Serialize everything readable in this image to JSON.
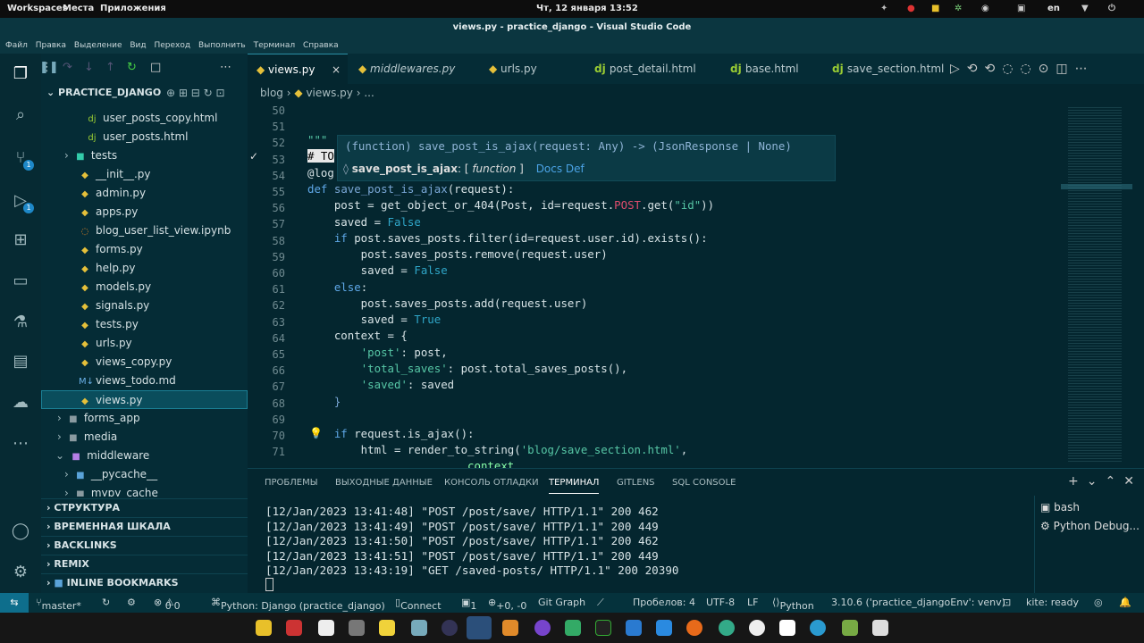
{
  "topbar": {
    "workspaces": "Workspaces",
    "places": "Места",
    "apps": "Приложения",
    "datetime": "Чт, 12 января  13:52",
    "lang": "en"
  },
  "window_title": "views.py - practice_django - Visual Studio Code",
  "menu": [
    "Файл",
    "Правка",
    "Выделение",
    "Вид",
    "Переход",
    "Выполнить",
    "Терминал",
    "Справка"
  ],
  "activity": {
    "badges": [
      "1",
      "1"
    ]
  },
  "sidebar": {
    "project": "PRACTICE_DJANGO",
    "items": [
      {
        "label": "user_posts_copy.html",
        "icon": "dj"
      },
      {
        "label": "user_posts.html",
        "icon": "dj"
      },
      {
        "label": "tests",
        "icon": "folder"
      },
      {
        "label": "__init__.py",
        "icon": "py"
      },
      {
        "label": "admin.py",
        "icon": "py"
      },
      {
        "label": "apps.py",
        "icon": "py"
      },
      {
        "label": "blog_user_list_view.ipynb",
        "icon": "nb"
      },
      {
        "label": "forms.py",
        "icon": "py"
      },
      {
        "label": "help.py",
        "icon": "py"
      },
      {
        "label": "models.py",
        "icon": "py"
      },
      {
        "label": "signals.py",
        "icon": "py"
      },
      {
        "label": "tests.py",
        "icon": "py"
      },
      {
        "label": "urls.py",
        "icon": "py"
      },
      {
        "label": "views_copy.py",
        "icon": "py"
      },
      {
        "label": "views_todo.md",
        "icon": "md"
      },
      {
        "label": "views.py",
        "icon": "py"
      },
      {
        "label": "forms_app",
        "icon": "folder"
      },
      {
        "label": "media",
        "icon": "folder"
      },
      {
        "label": "middleware",
        "icon": "folder"
      },
      {
        "label": "__pycache__",
        "icon": "folder"
      },
      {
        "label": "mypy_cache",
        "icon": "folder"
      }
    ],
    "sections": [
      "СТРУКТУРА",
      "ВРЕМЕННАЯ ШКАЛА",
      "BACKLINKS",
      "REMIX",
      "INLINE BOOKMARKS"
    ]
  },
  "tabs": [
    "views.py",
    "middlewares.py",
    "urls.py",
    "post_detail.html",
    "base.html",
    "save_section.html"
  ],
  "tab_icons": [
    "py",
    "py",
    "py",
    "dj",
    "dj",
    "dj"
  ],
  "breadcrumb": {
    "folder": "blog",
    "file": "views.py",
    "tail": "..."
  },
  "editor": {
    "line_numbers": [
      "50",
      "51",
      "52",
      "53",
      "54",
      "55",
      "56",
      "57",
      "58",
      "59",
      "60",
      "61",
      "62",
      "63",
      "64",
      "65",
      "66",
      "67",
      "68",
      "69",
      "70",
      "71"
    ],
    "hover_signature": "(function) save_post_is_ajax(request: Any) -> (JsonResponse | None)",
    "hover_name": "save_post_is_ajax",
    "hover_kind": "function",
    "hover_links": "Docs Def"
  },
  "panel": {
    "tabs": [
      "ПРОБЛЕМЫ",
      "ВЫХОДНЫЕ ДАННЫЕ",
      "КОНСОЛЬ ОТЛАДКИ",
      "ТЕРМИНАЛ",
      "GITLENS",
      "SQL CONSOLE"
    ],
    "terminal_lines": [
      "[12/Jan/2023 13:41:48] \"POST /post/save/ HTTP/1.1\" 200 462",
      "[12/Jan/2023 13:41:49] \"POST /post/save/ HTTP/1.1\" 200 449",
      "[12/Jan/2023 13:41:50] \"POST /post/save/ HTTP/1.1\" 200 462",
      "[12/Jan/2023 13:41:51] \"POST /post/save/ HTTP/1.1\" 200 449",
      "[12/Jan/2023 13:43:19] \"GET /saved-posts/ HTTP/1.1\" 200 20390"
    ],
    "terminals": [
      "bash",
      "Python Debug..."
    ]
  },
  "status": {
    "branch": "master*",
    "problems": "0",
    "warnings": "0",
    "python_env": "Python: Django (practice_django)",
    "connect": "Connect",
    "changes": "1",
    "diff": "+0, -0",
    "gitgraph": "Git Graph",
    "spaces": "Пробелов: 4",
    "encoding": "UTF-8",
    "eol": "LF",
    "language": "Python",
    "interpreter": "3.10.6 ('practice_djangoEnv': venv)",
    "kite": "kite: ready"
  }
}
